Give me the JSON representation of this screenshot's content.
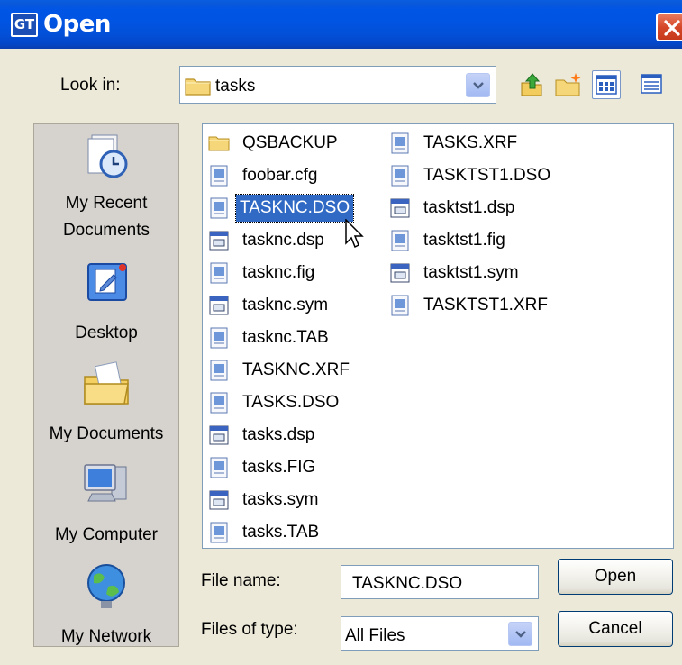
{
  "window": {
    "title": "Open",
    "app_icon_text": "GT"
  },
  "look_in": {
    "label": "Look in:",
    "value": "tasks"
  },
  "places": [
    {
      "name": "recent",
      "label_line1": "My Recent",
      "label_line2": "Documents",
      "icon": "recent-documents-icon"
    },
    {
      "name": "desktop",
      "label_line1": "Desktop",
      "label_line2": "",
      "icon": "desktop-icon"
    },
    {
      "name": "documents",
      "label_line1": "My Documents",
      "label_line2": "",
      "icon": "my-documents-icon"
    },
    {
      "name": "computer",
      "label_line1": "My Computer",
      "label_line2": "",
      "icon": "my-computer-icon"
    },
    {
      "name": "network",
      "label_line1": "My Network",
      "label_line2": "",
      "icon": "my-network-icon"
    }
  ],
  "files": {
    "column1": [
      {
        "name": "QSBACKUP",
        "type": "folder"
      },
      {
        "name": "foobar.cfg",
        "type": "file"
      },
      {
        "name": "TASKNC.DSO",
        "type": "file",
        "selected": true
      },
      {
        "name": "tasknc.dsp",
        "type": "window"
      },
      {
        "name": "tasknc.fig",
        "type": "file"
      },
      {
        "name": "tasknc.sym",
        "type": "window"
      },
      {
        "name": "tasknc.TAB",
        "type": "file"
      },
      {
        "name": "TASKNC.XRF",
        "type": "file"
      },
      {
        "name": "TASKS.DSO",
        "type": "file"
      },
      {
        "name": "tasks.dsp",
        "type": "window"
      },
      {
        "name": "tasks.FIG",
        "type": "file"
      },
      {
        "name": "tasks.sym",
        "type": "window"
      },
      {
        "name": "tasks.TAB",
        "type": "file"
      }
    ],
    "column2": [
      {
        "name": "TASKS.XRF",
        "type": "file"
      },
      {
        "name": "TASKTST1.DSO",
        "type": "file"
      },
      {
        "name": "tasktst1.dsp",
        "type": "window"
      },
      {
        "name": "tasktst1.fig",
        "type": "file"
      },
      {
        "name": "tasktst1.sym",
        "type": "window"
      },
      {
        "name": "TASKTST1.XRF",
        "type": "file"
      }
    ]
  },
  "file_name": {
    "label": "File name:",
    "value": "TASKNC.DSO"
  },
  "files_of_type": {
    "label": "Files of type:",
    "value": "All Files"
  },
  "buttons": {
    "open": "Open",
    "cancel": "Cancel"
  },
  "colors": {
    "titlebar": "#0054e3",
    "selection": "#316ac5",
    "dialog_bg": "#ece9d8",
    "close": "#d6482a"
  }
}
